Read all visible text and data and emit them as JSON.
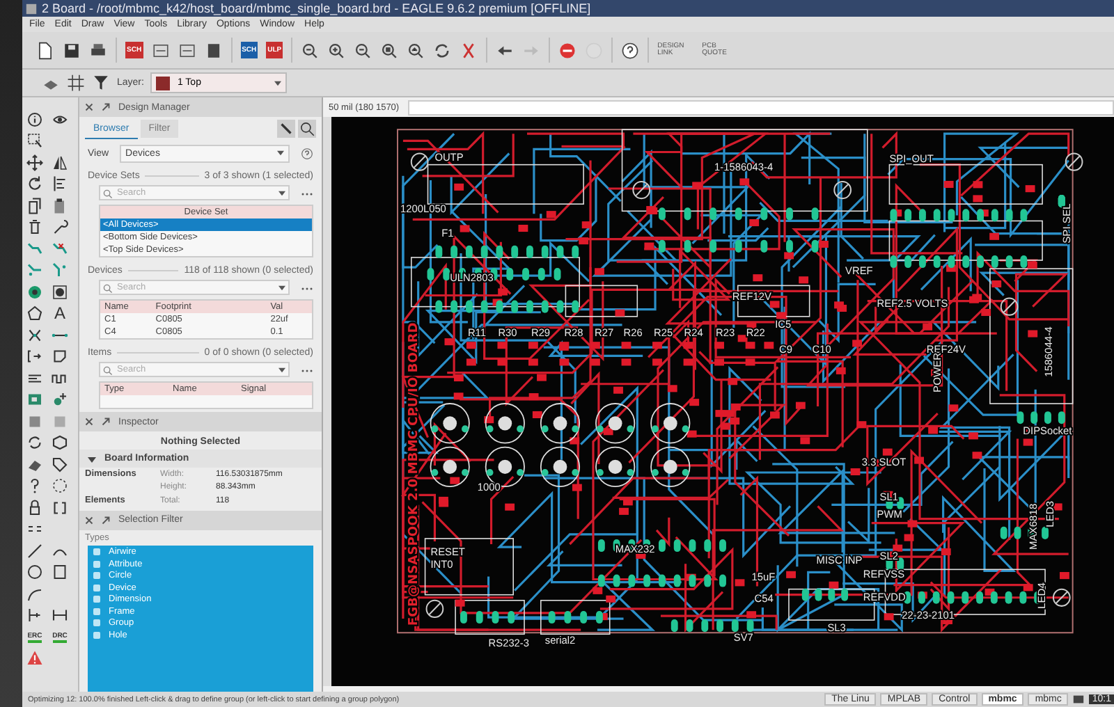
{
  "window": {
    "title": "2 Board - /root/mbmc_k42/host_board/mbmc_single_board.brd - EAGLE 9.6.2 premium [OFFLINE]"
  },
  "menu": [
    "File",
    "Edit",
    "Draw",
    "View",
    "Tools",
    "Library",
    "Options",
    "Window",
    "Help"
  ],
  "toolbar": {
    "badges": [
      "SCH",
      "SCH",
      "ULP"
    ],
    "links": [
      "DESIGN LINK",
      "PCB QUOTE"
    ],
    "layer_label": "Layer:",
    "layer": {
      "value": "1 Top",
      "color": "#8b2a2a"
    }
  },
  "tool_texts": [
    "A",
    "ERC",
    "DRC"
  ],
  "design_manager": {
    "title": "Design Manager",
    "tabs": [
      {
        "label": "Browser",
        "selected": true
      },
      {
        "label": "Filter",
        "selected": false
      }
    ],
    "view_label": "View",
    "view": "Devices",
    "device_sets": {
      "title": "Device Sets",
      "count": "3 of 3 shown (1 selected)",
      "placeholder": "Search",
      "column": "Device Set",
      "rows": [
        {
          "name": "<All Devices>",
          "selected": true
        },
        {
          "name": "<Bottom Side Devices>",
          "selected": false
        },
        {
          "name": "<Top Side Devices>",
          "selected": false
        }
      ]
    },
    "devices": {
      "title": "Devices",
      "count": "118 of 118 shown (0 selected)",
      "placeholder": "Search",
      "columns": [
        "Name",
        "Footprint",
        "Val"
      ],
      "rows": [
        [
          "C1",
          "C0805",
          "22uf"
        ],
        [
          "C4",
          "C0805",
          "0.1"
        ]
      ]
    },
    "items": {
      "title": "Items",
      "count": "0 of 0 shown (0 selected)",
      "placeholder": "Search",
      "columns": [
        "Type",
        "Name",
        "Signal"
      ]
    }
  },
  "inspector": {
    "title": "Inspector",
    "status": "Nothing Selected",
    "section": {
      "title": "Board Information",
      "expanded": true
    },
    "fields": [
      {
        "group": "Dimensions",
        "label": "Width:",
        "value": "116.53031875mm"
      },
      {
        "label": "Height:",
        "value": "88.343mm"
      },
      {
        "group": "Elements",
        "label": "Total:",
        "value": "118"
      }
    ]
  },
  "selection_filter": {
    "title": "Selection Filter",
    "types_label": "Types",
    "types": [
      {
        "name": "Airwire",
        "selected": true
      },
      {
        "name": "Attribute",
        "selected": true
      },
      {
        "name": "Circle",
        "selected": true
      },
      {
        "name": "Device",
        "selected": true
      },
      {
        "name": "Dimension",
        "selected": true
      },
      {
        "name": "Frame",
        "selected": true
      },
      {
        "name": "Group",
        "selected": true
      },
      {
        "name": "Hole",
        "selected": true
      }
    ]
  },
  "command_line": {
    "coordinates": "50 mil (180 1570)"
  },
  "board_labels": [
    {
      "text": "OUTP"
    },
    {
      "text": "1-1586043-4"
    },
    {
      "text": "SPI_OUT"
    },
    {
      "text": "1200L050"
    },
    {
      "text": "F1"
    },
    {
      "text": "ULN2803"
    },
    {
      "text": "REF12V"
    },
    {
      "text": "REF2.5 VOLTS"
    },
    {
      "text": "IC5"
    },
    {
      "text": "R11"
    },
    {
      "text": "R30"
    },
    {
      "text": "R29"
    },
    {
      "text": "R28"
    },
    {
      "text": "R27"
    },
    {
      "text": "R26"
    },
    {
      "text": "R25"
    },
    {
      "text": "R24"
    },
    {
      "text": "R23"
    },
    {
      "text": "R22"
    },
    {
      "text": "C9"
    },
    {
      "text": "C10"
    },
    {
      "text": "REF24V"
    },
    {
      "text": "POWER"
    },
    {
      "text": "1586044-4"
    },
    {
      "text": "SPI SEL"
    },
    {
      "text": "FGB@NSASPOOK 2.0 MBMC CPU/IO BOARD"
    },
    {
      "text": "MAX232"
    },
    {
      "text": "RS232-3"
    },
    {
      "text": "serial2"
    },
    {
      "text": "SV7"
    },
    {
      "text": "SL3"
    },
    {
      "text": "REFVSS"
    },
    {
      "text": "REFVDD"
    },
    {
      "text": "MISC INP"
    },
    {
      "text": "22-23-2101"
    },
    {
      "text": "3.3 SLOT"
    },
    {
      "text": "SL1"
    },
    {
      "text": "PWM"
    },
    {
      "text": "SL2"
    },
    {
      "text": "DIPSocket"
    },
    {
      "text": "MAX6818"
    },
    {
      "text": "LED3"
    },
    {
      "text": "LED4"
    },
    {
      "text": "15uF"
    },
    {
      "text": "C54"
    },
    {
      "text": "RESET"
    },
    {
      "text": "INT0"
    },
    {
      "text": "1000"
    },
    {
      "text": "VREF"
    }
  ],
  "status_bar": "Optimizing 12: 100.0% finished Left-click & drag to define group (or left-click to start defining a group polygon)",
  "taskbar": [
    {
      "label": "The Linu",
      "selected": false
    },
    {
      "label": "MPLAB",
      "selected": false
    },
    {
      "label": "Control",
      "selected": false
    },
    {
      "label": "mbmc",
      "selected": true
    },
    {
      "label": "mbmc",
      "selected": false
    }
  ],
  "clock": "10:1"
}
